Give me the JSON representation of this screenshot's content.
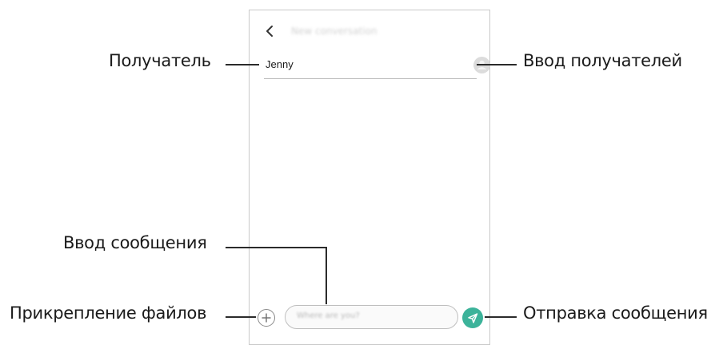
{
  "callouts": {
    "recipient": "Получатель",
    "recipient_input": "Ввод получателей",
    "message_input": "Ввод сообщения",
    "attach_files": "Прикрепление файлов",
    "send_message": "Отправка сообщения"
  },
  "screen": {
    "title": "New conversation",
    "recipient_value": "Jenny",
    "message_placeholder": "Where are you?"
  },
  "colors": {
    "send_button": "#3cb39a",
    "callout_line": "#2b2b2b"
  },
  "icons": {
    "back": "chevron-left-icon",
    "contact": "contact-icon",
    "attach": "plus-icon",
    "send": "send-icon"
  }
}
